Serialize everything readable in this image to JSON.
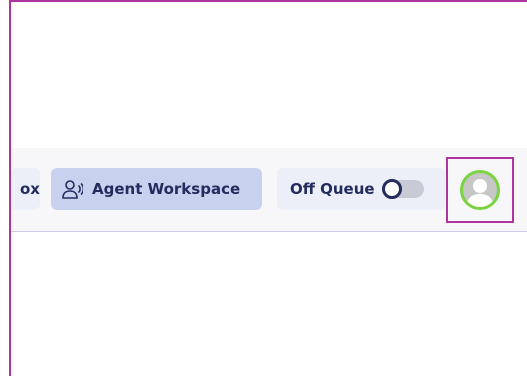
{
  "topbar": {
    "inbox_tab_label": "ox",
    "workspace_tab_label": "Agent Workspace",
    "queue_label": "Off Queue",
    "queue_toggle_on": false
  },
  "icons": {
    "workspace": "headset-user-icon",
    "avatar": "user-avatar-icon"
  },
  "colors": {
    "highlight_border": "#b0349e",
    "active_tab_bg": "#c8d2ef",
    "tab_bg": "#eceef8",
    "text": "#232c5c",
    "avatar_ring": "#7cd341"
  }
}
